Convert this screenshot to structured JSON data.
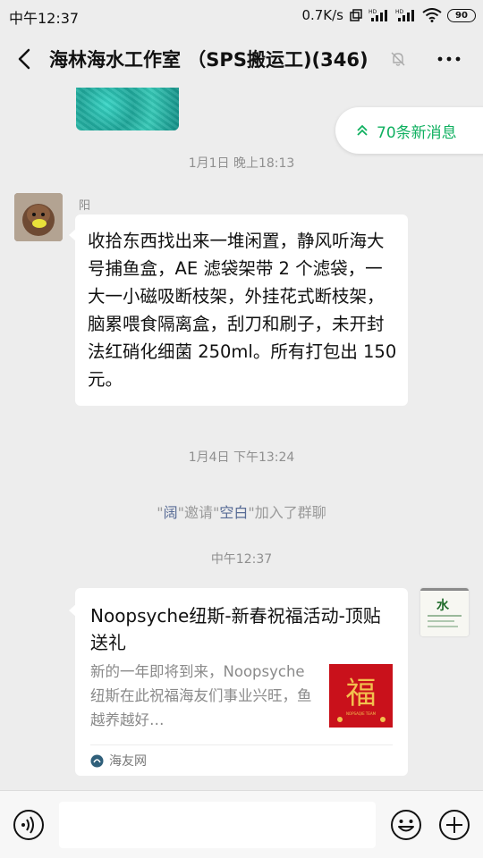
{
  "status_bar": {
    "time": "中午12:37",
    "network_speed": "0.7K/s",
    "battery": "90",
    "icons": [
      "screen-rotate-icon",
      "hd-signal-icon",
      "hd-signal-icon",
      "wifi-icon",
      "battery-icon"
    ]
  },
  "header": {
    "title": "海林海水工作室 （SPS搬运工)(346)",
    "icons": [
      "back-arrow-icon",
      "mute-bell-icon",
      "more-dots-icon"
    ]
  },
  "new_messages": {
    "label": "70条新消息",
    "icon": "double-chevron-up-icon",
    "color": "#10b060"
  },
  "timestamps": {
    "t1": "1月1日 晚上18:13",
    "t2": "1月4日 下午13:24",
    "t3": "中午12:37"
  },
  "message": {
    "sender": "阳",
    "text": "收拾东西找出来一堆闲置，静风听海大号捕鱼盒，AE 滤袋架带 2 个滤袋，一大一小磁吸断枝架，外挂花式断枝架，脑累喂食隔离盒，刮刀和刷子，未开封法红硝化细菌 250ml。所有打包出 150 元。"
  },
  "system_notice": {
    "q1": "\"",
    "inviter": "阔",
    "q2": "\"邀请\"",
    "invitee": "空白",
    "q3": "\"加入了群聊"
  },
  "link_card": {
    "title": "Noopsyche纽斯-新春祝福活动-顶贴送礼",
    "description": "新的一年即将到来，Noopsyche纽斯在此祝福海友们事业兴旺，鱼越养越好…",
    "source": "海友网",
    "thumb_char": "福",
    "thumb_caption": "NOPSAQIE TEAM",
    "side_char": "水"
  },
  "input_bar": {
    "value": "",
    "icons": [
      "voice-icon",
      "emoji-icon",
      "plus-icon"
    ]
  },
  "colors": {
    "background": "#ededed",
    "bubble": "#ffffff",
    "accent_green": "#10b060",
    "link_blue": "#576b95"
  }
}
